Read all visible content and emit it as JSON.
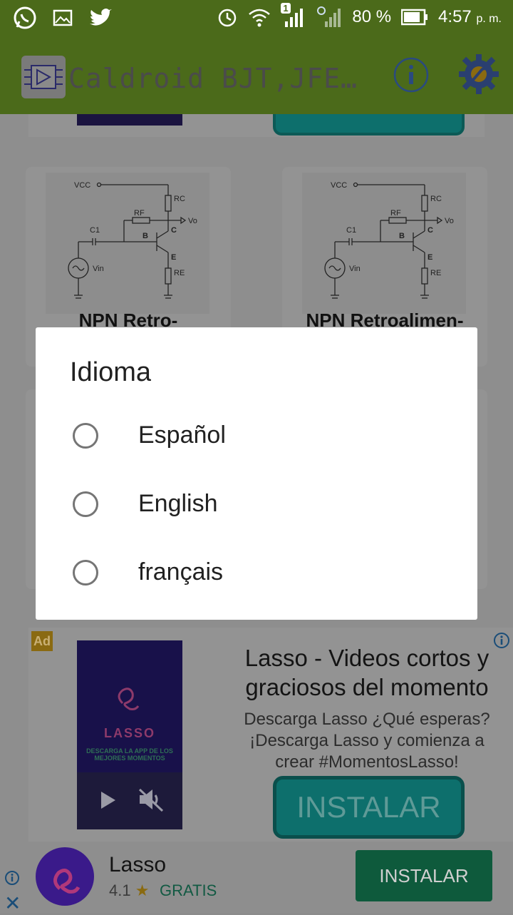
{
  "status_bar": {
    "battery": "80 %",
    "time": "4:57",
    "ampm": "p. m.",
    "notification_count": "1",
    "icons": [
      "whatsapp-icon",
      "gallery-icon",
      "twitter-icon",
      "alarm-icon",
      "wifi-icon",
      "signal-icon",
      "battery-icon"
    ]
  },
  "app_bar": {
    "title": "Caldroid BJT,JFE…",
    "accent": "#4b6a1a"
  },
  "cards": [
    {
      "title": "NPN Retro-"
    },
    {
      "title": "NPN Retroalimen-"
    }
  ],
  "dialog": {
    "title": "Idioma",
    "options": [
      {
        "label": "Español"
      },
      {
        "label": "English"
      },
      {
        "label": "français"
      }
    ]
  },
  "ad": {
    "badge": "Ad",
    "title": "Lasso - Videos cortos y graciosos del momento",
    "description": "Descarga Lasso ¿Qué esperas? ¡Descarga Lasso y comienza a crear #MomentosLasso!",
    "install_label": "INSTALAR",
    "video_brand": "LASSO",
    "video_line": "DESCARGA LA APP DE LOS MEJORES MOMENTOS"
  },
  "bottom_banner": {
    "app_name": "Lasso",
    "rating": "4.1",
    "price": "GRATIS",
    "install_label": "INSTALAR"
  }
}
